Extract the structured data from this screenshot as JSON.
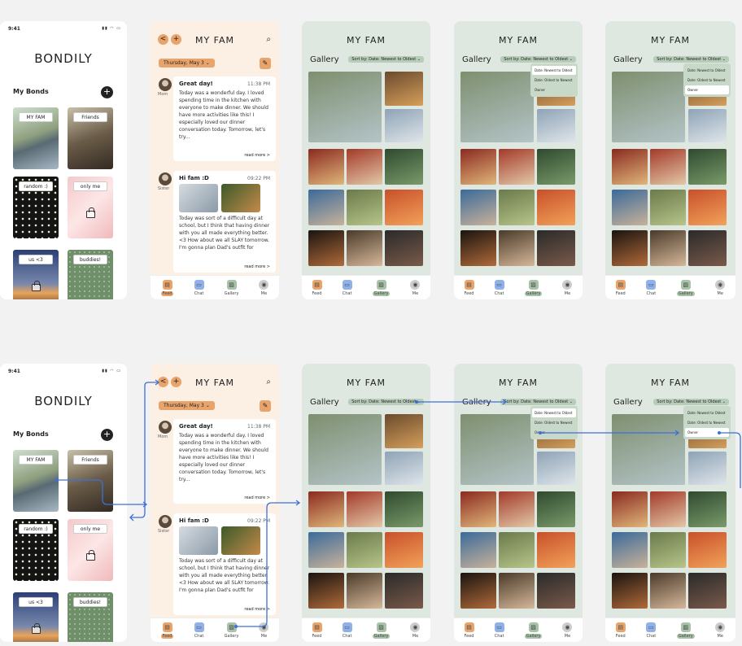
{
  "status": {
    "time": "9:41",
    "icons": "▮▮ ◠ ▭"
  },
  "home": {
    "brand": "BONDILY",
    "section": "My Bonds",
    "add": "+",
    "bonds": [
      {
        "label": "MY FAM",
        "locked": false
      },
      {
        "label": "Friends",
        "locked": false
      },
      {
        "label": "random :)",
        "locked": false
      },
      {
        "label": "only me",
        "locked": true
      },
      {
        "label": "us <3",
        "locked": true
      },
      {
        "label": "buddies!",
        "locked": false
      }
    ]
  },
  "feed": {
    "title": "MY FAM",
    "back": "<",
    "add": "+",
    "search": "⌕",
    "date": "Thursday, May 3",
    "caret": "⌄",
    "edit": "✎",
    "posts": [
      {
        "author": "Mom",
        "title": "Great day!",
        "time": "11:38 PM",
        "body": "Today was a wonderful day. I loved spending time in the kitchen with everyone to make dinner. We should have more activities like this! I especially loved our dinner conversation today. Tomorrow, let's try...",
        "more": "read more >"
      },
      {
        "author": "Sister",
        "title": "Hi fam :D",
        "time": "09:22 PM",
        "body": "Today was sort of a difficult day at school, but I think that having dinner with you all made everything better. <3 How about we all SLAY tomorrow. I'm gonna plan Dad's outfit for",
        "more": "read more >"
      }
    ]
  },
  "tabs": [
    {
      "label": "Feed",
      "icon": "▤"
    },
    {
      "label": "Chat",
      "icon": "▭"
    },
    {
      "label": "Gallery",
      "icon": "▨"
    },
    {
      "label": "Me",
      "icon": "◉"
    }
  ],
  "gallery": {
    "title": "MY FAM",
    "heading": "Gallery",
    "sort": "Sort by: Date: Newest to Oldest ⌄",
    "options": [
      "Date: Newest to Oldest",
      "Date: Oldest to Newest",
      "Owner"
    ]
  },
  "colors": {
    "feed_bg": "#fcefe4",
    "gallery_bg": "#dfe7e1",
    "accent": "#e9a46c",
    "arrow": "#3e6fd9"
  }
}
